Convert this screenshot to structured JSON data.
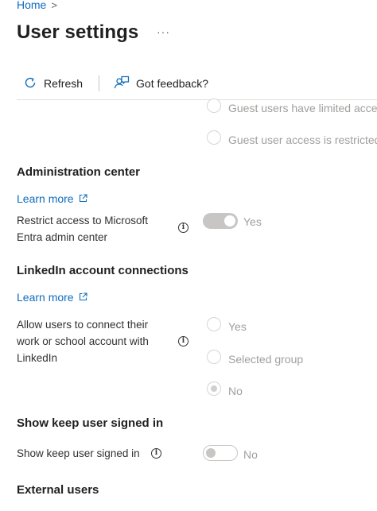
{
  "breadcrumb": {
    "home": "Home",
    "separator": ">"
  },
  "page": {
    "title": "User settings",
    "more": "···"
  },
  "toolbar": {
    "refresh_label": "Refresh",
    "feedback_label": "Got feedback?"
  },
  "guest_access": {
    "option_top": "Guest users have limited access",
    "option_restricted": "Guest user access is restricted t"
  },
  "admin_center": {
    "title": "Administration center",
    "learn_more": "Learn more",
    "label_line1": "Restrict access to Microsoft",
    "label_line2": "Entra admin center",
    "toggle_state": "Yes"
  },
  "linkedin": {
    "title": "LinkedIn account connections",
    "learn_more": "Learn more",
    "label_line1": "Allow users to connect their",
    "label_line2": "work or school account with",
    "label_line3": "LinkedIn",
    "options": [
      "Yes",
      "Selected group",
      "No"
    ],
    "selected": "No"
  },
  "keep_signed_in": {
    "title": "Show keep user signed in",
    "label": "Show keep user signed in",
    "toggle_state": "No"
  },
  "external_users": {
    "title": "External users"
  },
  "colors": {
    "accent": "#0f6cbd",
    "muted": "#a19f9d",
    "text": "#323130"
  }
}
